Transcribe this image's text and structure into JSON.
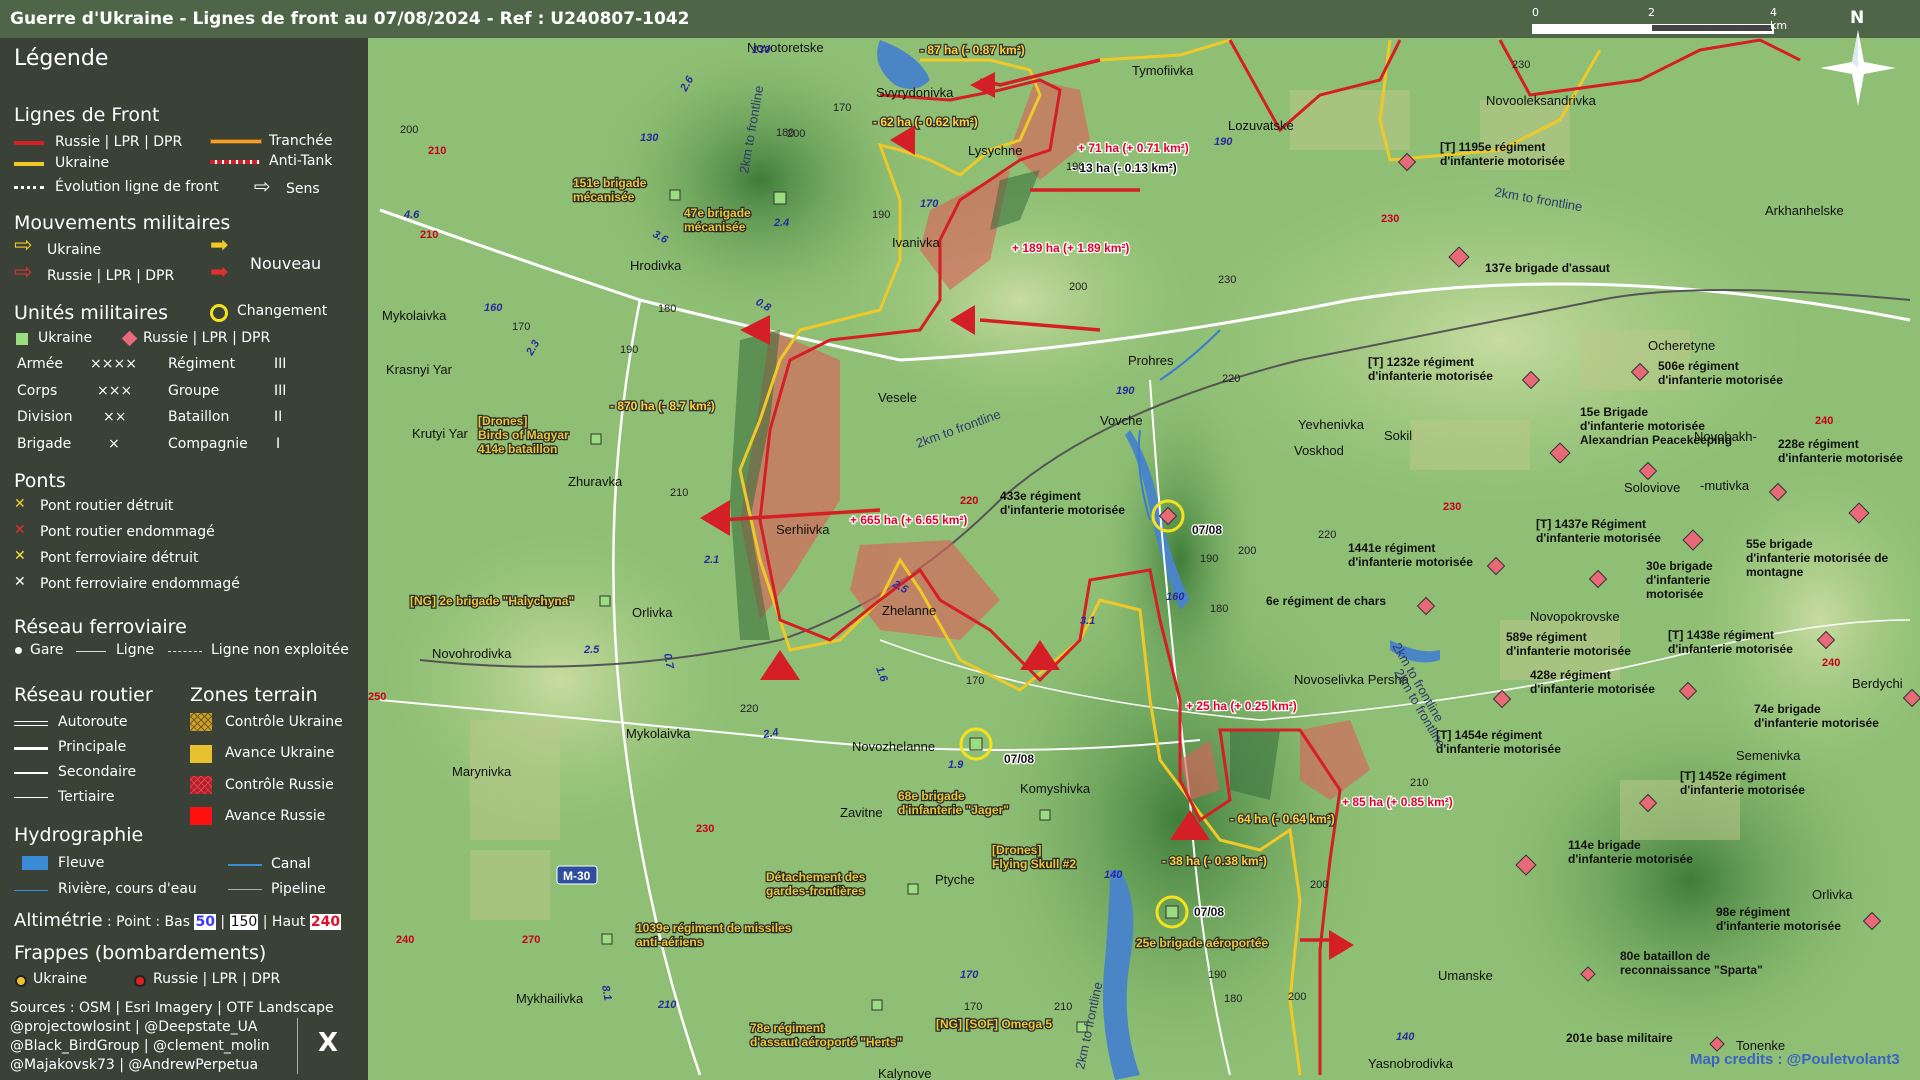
{
  "header": {
    "title": "Guerre d'Ukraine - Lignes de front au 07/08/2024 - Ref : U240807-1042",
    "scale": {
      "labels": [
        "0",
        "2",
        "4 km"
      ]
    },
    "north": "N"
  },
  "legend": {
    "title": "Légende",
    "front_lines": {
      "heading": "Lignes de Front",
      "russia": "Russie | LPR | DPR",
      "ukraine": "Ukraine",
      "evolution": "Évolution ligne de front",
      "trench": "Tranchée",
      "anti_tank": "Anti-Tank",
      "direction": "Sens"
    },
    "movements": {
      "heading": "Mouvements militaires",
      "ukraine": "Ukraine",
      "russia": "Russie | LPR | DPR",
      "new": "Nouveau"
    },
    "units": {
      "heading": "Unités militaires",
      "change": "Changement",
      "ukraine": "Ukraine",
      "russia": "Russie | LPR | DPR",
      "levels": [
        {
          "name": "Armée",
          "sym": "××××"
        },
        {
          "name": "Corps",
          "sym": "×××"
        },
        {
          "name": "Division",
          "sym": "××"
        },
        {
          "name": "Brigade",
          "sym": "×"
        }
      ],
      "levels2": [
        {
          "name": "Régiment",
          "sym": "III"
        },
        {
          "name": "Groupe",
          "sym": "III"
        },
        {
          "name": "Bataillon",
          "sym": "II"
        },
        {
          "name": "Compagnie",
          "sym": "I"
        }
      ]
    },
    "bridges": {
      "heading": "Ponts",
      "items": [
        "Pont routier détruit",
        "Pont routier endommagé",
        "Pont ferroviaire détruit",
        "Pont ferroviaire endommagé"
      ]
    },
    "rail": {
      "heading": "Réseau ferroviaire",
      "station": "Gare",
      "line": "Ligne",
      "unused": "Ligne non exploitée"
    },
    "roads": {
      "heading": "Réseau routier",
      "items": [
        "Autoroute",
        "Principale",
        "Secondaire",
        "Tertiaire"
      ]
    },
    "zones": {
      "heading": "Zones terrain",
      "items": [
        "Contrôle Ukraine",
        "Avance Ukraine",
        "Contrôle Russie",
        "Avance Russie"
      ]
    },
    "hydro": {
      "heading": "Hydrographie",
      "river_big": "Fleuve",
      "canal": "Canal",
      "river": "Rivière, cours d'eau",
      "pipeline": "Pipeline"
    },
    "altimetry": {
      "label": "Altimétrie",
      "text": ": Point : Bas",
      "low": "50",
      "mid": "150",
      "high_label": "| Haut",
      "high": "240"
    },
    "strikes": {
      "heading": "Frappes (bombardements)",
      "ukraine": "Ukraine",
      "russia": "Russie | LPR | DPR"
    },
    "sources": [
      "Sources : OSM | Esri Imagery | OTF Landscape",
      "@projectowlosint | @Deepstate_UA",
      "@Black_BirdGroup | @clement_molin",
      "@Majakovsk73 | @AndrewPerpetua"
    ],
    "x_icon": "X"
  },
  "map": {
    "credits": "Map credits : @Pouletvolant3",
    "towns": [
      {
        "t": "Novotoretske"
      },
      {
        "t": "Tymofiivka"
      },
      {
        "t": "Lozuvatske"
      },
      {
        "t": "Svyrydonivka"
      },
      {
        "t": "Lysychne"
      },
      {
        "t": "Ivanivka"
      },
      {
        "t": "Hrodivka"
      },
      {
        "t": "Mykolaivka"
      },
      {
        "t": "Krasnyi Yar"
      },
      {
        "t": "Krutyi Yar"
      },
      {
        "t": "Vesele"
      },
      {
        "t": "Zhuravka"
      },
      {
        "t": "Serhiivka"
      },
      {
        "t": "Zhelanne"
      },
      {
        "t": "Orlivka"
      },
      {
        "t": "Novohrodivka"
      },
      {
        "t": "Mykolaivka"
      },
      {
        "t": "Novozhelanne"
      },
      {
        "t": "Marynivka"
      },
      {
        "t": "Komyshivka"
      },
      {
        "t": "Zavitne"
      },
      {
        "t": "Ptyche"
      },
      {
        "t": "Mykhailivka"
      },
      {
        "t": "Kalynove"
      },
      {
        "t": "Prohres"
      },
      {
        "t": "Vovche"
      },
      {
        "t": "Yevhenivka"
      },
      {
        "t": "Sokil"
      },
      {
        "t": "Voskhod"
      },
      {
        "t": "Novooleksandrivka"
      },
      {
        "t": "Arkhanhelske"
      },
      {
        "t": "Ocheretyne"
      },
      {
        "t": "Novobakh-"
      },
      {
        "t": "-mutivka"
      },
      {
        "t": "Soloviove"
      },
      {
        "t": "Novopokrovske"
      },
      {
        "t": "Novoselivka Persha"
      },
      {
        "t": "Berdychi"
      },
      {
        "t": "Semenivka"
      },
      {
        "t": "Orlivka"
      },
      {
        "t": "Umanske"
      },
      {
        "t": "Tonenke"
      },
      {
        "t": "Yasnobrodivka"
      }
    ],
    "changes": [
      {
        "t": "- 87 ha (- 0.87 km²)",
        "c": "y"
      },
      {
        "t": "- 62 ha (- 0.62 km²)",
        "c": "y"
      },
      {
        "t": "+ 71 ha (+ 0.71 km²)",
        "c": "r"
      },
      {
        "t": "- 13 ha (- 0.13 km²)",
        "c": "k"
      },
      {
        "t": "+ 189 ha (+ 1.89 km²)",
        "c": "r"
      },
      {
        "t": "- 870 ha (- 8.7 km²)",
        "c": "y"
      },
      {
        "t": "+ 665 ha (+ 6.65 km²)",
        "c": "r"
      },
      {
        "t": "+ 25 ha (+ 0.25 km²)",
        "c": "r"
      },
      {
        "t": "- 64 ha (- 0.64 km²)",
        "c": "y"
      },
      {
        "t": "+ 85 ha (+ 0.85 km²)",
        "c": "r"
      },
      {
        "t": "- 38 ha (- 0.38 km²)",
        "c": "y"
      }
    ],
    "ua_units": [
      {
        "l1": "151e brigade",
        "l2": "mécanisée"
      },
      {
        "l1": "47e brigade",
        "l2": "mécanisée"
      },
      {
        "l1": "[Drones]",
        "l2": "Birds of Magyar",
        "l3": "414e bataillon"
      },
      {
        "l1": "[NG] 2e brigade \"Halychyna\""
      },
      {
        "l1": "68e brigade",
        "l2": "d'infanterie \"Jager\""
      },
      {
        "l1": "[Drones]",
        "l2": "Flying Skull #2"
      },
      {
        "l1": "Détachement des",
        "l2": "gardes-frontières"
      },
      {
        "l1": "1039e régiment de missiles",
        "l2": "anti-aériens"
      },
      {
        "l1": "25e brigade aéroportée"
      },
      {
        "l1": "78e régiment",
        "l2": "d'assaut aéroporté \"Herts\""
      },
      {
        "l1": "[NG] [SOF] Omega 5"
      }
    ],
    "ru_units": [
      {
        "l1": "[T] 1195e régiment",
        "l2": "d'infanterie motorisée"
      },
      {
        "l1": "137e brigade d'assaut"
      },
      {
        "l1": "[T] 1232e régiment",
        "l2": "d'infanterie motorisée"
      },
      {
        "l1": "506e régiment",
        "l2": "d'infanterie motorisée"
      },
      {
        "l1": "15e Brigade",
        "l2": "d'infanterie motorisée",
        "l3": "Alexandrian Peacekeeping"
      },
      {
        "l1": "228e régiment",
        "l2": "d'infanterie motorisée"
      },
      {
        "l1": "433e régiment",
        "l2": "d'infanterie motorisée"
      },
      {
        "l1": "[T] 1437e Régiment",
        "l2": "d'infanterie motorisée"
      },
      {
        "l1": "55e brigade",
        "l2": "d'infanterie motorisée de",
        "l3": "montagne"
      },
      {
        "l1": "1441e régiment",
        "l2": "d'infanterie motorisée"
      },
      {
        "l1": "30e brigade",
        "l2": "d'infanterie",
        "l3": "motorisée"
      },
      {
        "l1": "6e régiment de chars"
      },
      {
        "l1": "589e régiment",
        "l2": "d'infanterie motorisée"
      },
      {
        "l1": "[T] 1438e régiment",
        "l2": "d'infanterie motorisée"
      },
      {
        "l1": "428e régiment",
        "l2": "d'infanterie motorisée"
      },
      {
        "l1": "74e brigade",
        "l2": "d'infanterie motorisée"
      },
      {
        "l1": "[T] 1454e régiment",
        "l2": "d'infanterie motorisée"
      },
      {
        "l1": "[T] 1452e régiment",
        "l2": "d'infanterie motorisée"
      },
      {
        "l1": "114e brigade",
        "l2": "d'infanterie motorisée"
      },
      {
        "l1": "98e régiment",
        "l2": "d'infanterie motorisée"
      },
      {
        "l1": "80e bataillon de",
        "l2": "reconnaissance \"Sparta\""
      },
      {
        "l1": "201e base militaire"
      }
    ],
    "dates": [
      "07/08",
      "07/08",
      "07/08"
    ],
    "frontline_notes": [
      "2km to frontline",
      "2km to frontline",
      "2km to frontline",
      "2km to frontline",
      "2km to frontline",
      "2km to frontline"
    ],
    "highway": "M-30",
    "altitudes": [
      "230",
      "200",
      "210",
      "210",
      "200",
      "170",
      "180",
      "190",
      "180",
      "190",
      "170",
      "190",
      "200",
      "230",
      "230",
      "210",
      "220",
      "220",
      "230",
      "240",
      "200",
      "220",
      "210",
      "180",
      "190",
      "170",
      "220",
      "250",
      "230",
      "270",
      "240",
      "240",
      "210",
      "200",
      "190",
      "180",
      "210",
      "170",
      "200",
      "160",
      "170",
      "180",
      "190",
      "140",
      "240"
    ],
    "road_numbers": [
      "130",
      "130",
      "2.6",
      "4.6",
      "3.6",
      "0.8",
      "2.3",
      "2.4",
      "160",
      "170",
      "190",
      "190",
      "160",
      "140",
      "170",
      "210",
      "2.1",
      "2.5",
      "0.7",
      "1.6",
      "2.5",
      "3.1",
      "2.4",
      "1.9",
      "8.1",
      "140"
    ]
  }
}
